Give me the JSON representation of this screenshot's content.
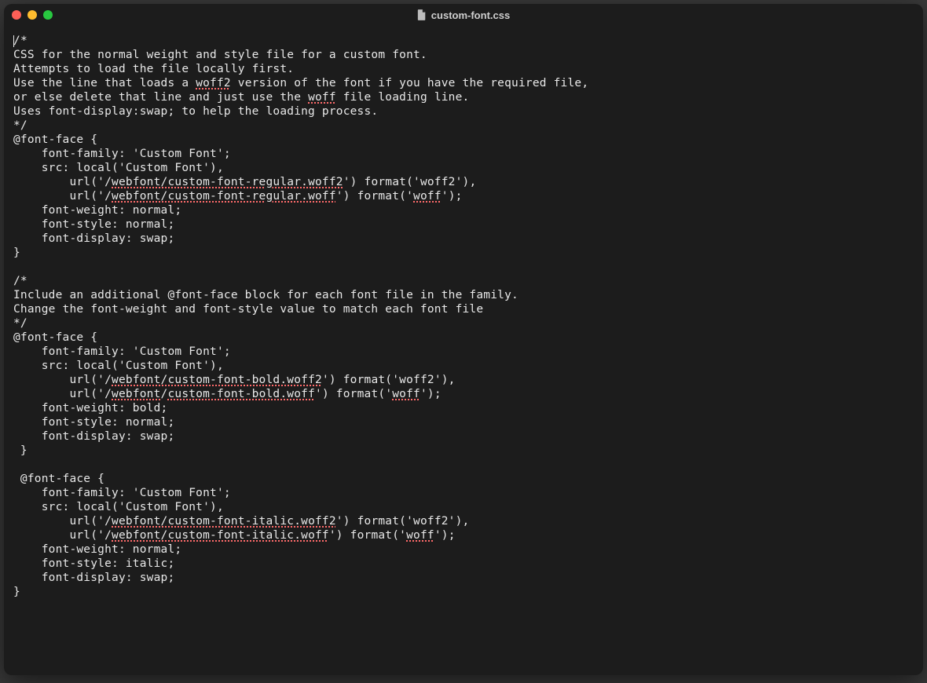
{
  "window": {
    "title": "custom-font.css"
  },
  "code": {
    "l01a": "/",
    "l01b": "*",
    "l02": "CSS for the normal weight and style file for a custom font.",
    "l03": "Attempts to load the file locally first.",
    "l04a": "Use the line that loads a ",
    "l04_sp": "woff2",
    "l04b": " version of the font if you have the required file,",
    "l05a": "or else delete that line and just use the ",
    "l05_sp": "woff",
    "l05b": " file loading line.",
    "l06": "Uses font-display:swap; to help the loading process.",
    "l07": "*/",
    "l08": "@font-face {",
    "l09": "    font-family: 'Custom Font';",
    "l10": "    src: local('Custom Font'),",
    "l11a": "        url('/",
    "l11_sp": "webfont/custom-font-regular.woff2",
    "l11b": "') format('woff2'),",
    "l12a": "        url('/",
    "l12_sp": "webfont/custom-font-regular.woff",
    "l12b": "') format('",
    "l12_sp2": "woff",
    "l12c": "');",
    "l13": "    font-weight: normal;",
    "l14": "    font-style: normal;",
    "l15": "    font-display: swap;",
    "l16": "}",
    "l17": "",
    "l18": "/*",
    "l19": "Include an additional @font-face block for each font file in the family.",
    "l20": "Change the font-weight and font-style value to match each font file",
    "l21": "*/",
    "l22": "@font-face {",
    "l23": "    font-family: 'Custom Font';",
    "l24": "    src: local('Custom Font'),",
    "l25a": "        url('/",
    "l25_sp": "webfont/custom-font-bold.woff2",
    "l25b": "') format('woff2'),",
    "l26a": "        url('/",
    "l26_sp1": "webfont",
    "l26m": "/",
    "l26_sp2": "custom-font-bold.woff",
    "l26b": "') format('",
    "l26_sp3": "woff",
    "l26c": "');",
    "l27": "    font-weight: bold;",
    "l28": "    font-style: normal;",
    "l29": "    font-display: swap;",
    "l30": " }",
    "l31": "",
    "l32": " @font-face {",
    "l33": "    font-family: 'Custom Font';",
    "l34": "    src: local('Custom Font'),",
    "l35a": "        url('/",
    "l35_sp": "webfont/custom-font-italic.woff2",
    "l35b": "') format('woff2'),",
    "l36a": "        url('/",
    "l36_sp": "webfont/custom-font-italic.woff",
    "l36b": "') format('",
    "l36_sp2": "woff",
    "l36c": "');",
    "l37": "    font-weight: normal;",
    "l38": "    font-style: italic;",
    "l39": "    font-display: swap;",
    "l40": "}"
  }
}
